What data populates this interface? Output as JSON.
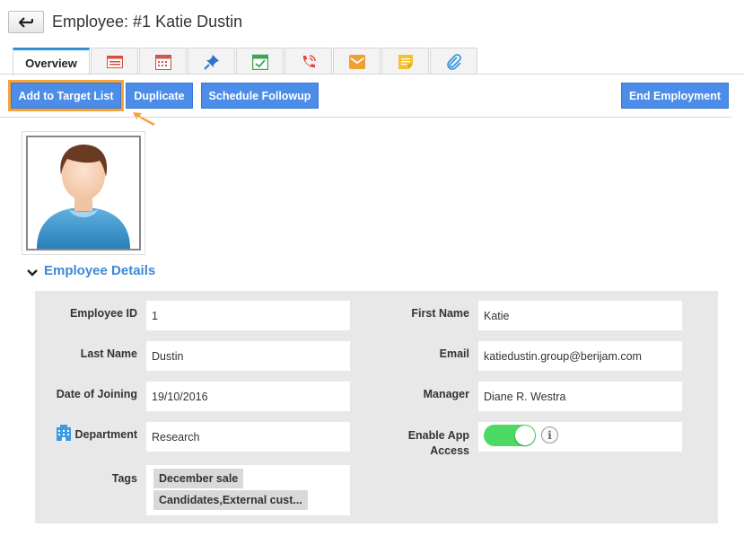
{
  "header": {
    "back_icon": "back-arrow-icon",
    "title": "Employee: #1 Katie Dustin"
  },
  "tabs": [
    {
      "label": "Overview",
      "active": true
    },
    {
      "icon": "details-card-icon",
      "color": "#e04b3f"
    },
    {
      "icon": "calendar-icon",
      "color": "#d9534f"
    },
    {
      "icon": "pin-icon",
      "color": "#2f74c9"
    },
    {
      "icon": "calendar-check-icon",
      "color": "#3aa655"
    },
    {
      "icon": "phone-call-icon",
      "color": "#e04b3f"
    },
    {
      "icon": "email-icon",
      "color": "#f0a033"
    },
    {
      "icon": "note-icon",
      "color": "#f3c22e"
    },
    {
      "icon": "paperclip-icon",
      "color": "#2f8fd8"
    }
  ],
  "toolbar": {
    "add_to_target_list": "Add to Target List",
    "duplicate": "Duplicate",
    "schedule_followup": "Schedule Followup",
    "end_employment": "End Employment"
  },
  "section": {
    "title": "Employee Details"
  },
  "fields": {
    "employee_id": {
      "label": "Employee ID",
      "value": "1"
    },
    "first_name": {
      "label": "First Name",
      "value": "Katie"
    },
    "last_name": {
      "label": "Last Name",
      "value": "Dustin"
    },
    "email": {
      "label": "Email",
      "value": "katiedustin.group@berijam.com"
    },
    "date_of_joining": {
      "label": "Date of Joining",
      "value": "19/10/2016"
    },
    "manager": {
      "label": "Manager",
      "value": "Diane R. Westra"
    },
    "department": {
      "label": "Department",
      "value": "Research"
    },
    "enable_app_access": {
      "label_line1": "Enable App",
      "label_line2": "Access",
      "enabled": true
    },
    "tags": {
      "label": "Tags",
      "values": [
        "December sale",
        "Candidates,External cust..."
      ]
    }
  },
  "colors": {
    "primary_button": "#4b8de8",
    "highlight": "#f5a43a",
    "section_title": "#3d87d8",
    "toggle_on": "#4cd964"
  }
}
